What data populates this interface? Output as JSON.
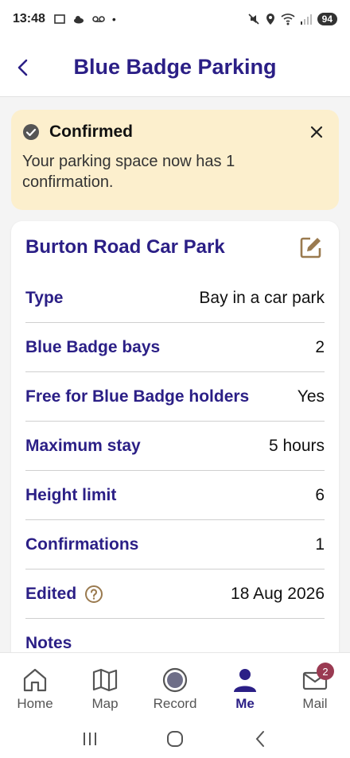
{
  "status": {
    "time": "13:48",
    "battery": "94"
  },
  "appbar": {
    "title": "Blue Badge Parking"
  },
  "banner": {
    "title": "Confirmed",
    "message": "Your parking space now has 1 confirmation."
  },
  "card": {
    "title": "Burton Road Car Park",
    "rows": [
      {
        "key": "Type",
        "value": "Bay in a car park"
      },
      {
        "key": "Blue Badge bays",
        "value": "2"
      },
      {
        "key": "Free for Blue Badge holders",
        "value": "Yes"
      },
      {
        "key": "Maximum stay",
        "value": "5 hours"
      },
      {
        "key": "Height limit",
        "value": "6"
      },
      {
        "key": "Confirmations",
        "value": "1"
      },
      {
        "key": "Edited",
        "value": "18 Aug 2026"
      },
      {
        "key": "Notes",
        "value": ""
      }
    ]
  },
  "nav": {
    "items": [
      {
        "label": "Home",
        "icon": "home-icon"
      },
      {
        "label": "Map",
        "icon": "map-icon"
      },
      {
        "label": "Record",
        "icon": "record-icon"
      },
      {
        "label": "Me",
        "icon": "person-icon"
      },
      {
        "label": "Mail",
        "icon": "mail-icon"
      }
    ],
    "mail_badge": "2",
    "active": "Me"
  },
  "colors": {
    "accent": "#2b1f86",
    "banner_bg": "#fcefcd",
    "edit_icon": "#9a7a4f",
    "badge": "#9a3a52"
  }
}
